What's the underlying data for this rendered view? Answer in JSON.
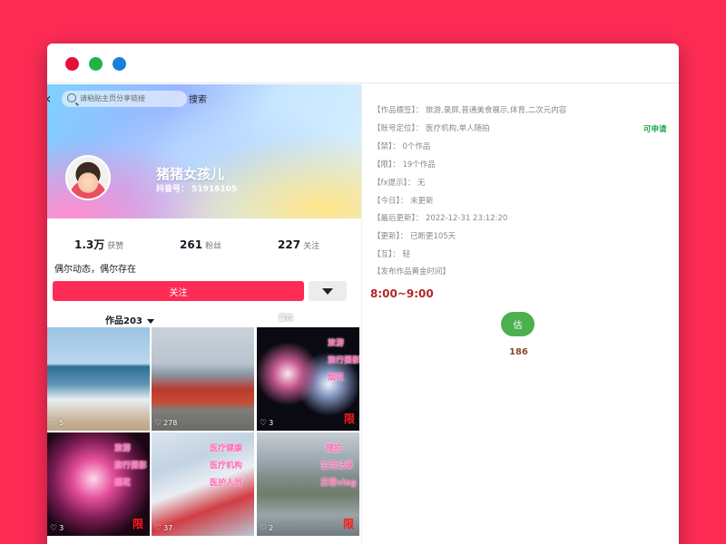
{
  "window": {
    "controls": [
      "close-dot",
      "minimize-dot",
      "maximize-dot"
    ],
    "colors": {
      "close": "#e2103a",
      "minimize": "#22b24c",
      "maximize": "#1a7fd8"
    }
  },
  "profile": {
    "search_placeholder": "请粘贴主页分享链接",
    "search_button": "搜索",
    "nickname": "猪猪女孩儿",
    "douyin_id": "抖音号： 51916105",
    "stats": [
      {
        "value": "1.3万",
        "label": "获赞"
      },
      {
        "value": "261",
        "label": "粉丝"
      },
      {
        "value": "227",
        "label": "关注"
      }
    ],
    "bio": "偶尔动态，偶尔存在",
    "follow_button": "关注",
    "tabs": {
      "works": "作品203",
      "likes": "喜欢"
    }
  },
  "grid": [
    {
      "likes": "5",
      "tags": [],
      "limit": ""
    },
    {
      "likes": "278",
      "tags": [],
      "limit": ""
    },
    {
      "likes": "3",
      "tags": [
        "旅游",
        "旅行摄影",
        "烟花"
      ],
      "limit": "限"
    },
    {
      "likes": "3",
      "tags": [
        "旅游",
        "旅行摄影",
        "烟花"
      ],
      "limit": "限"
    },
    {
      "likes": "37",
      "tags": [
        "医疗健康",
        "医疗机构",
        "医护人员"
      ],
      "limit": ""
    },
    {
      "likes": "2",
      "tags": [
        "随拍",
        "生活记录",
        "日常vlog"
      ],
      "limit": "限"
    }
  ],
  "info": {
    "lines": [
      "【作品標签】： 旅游,录屏,普通美食展示,体育,二次元内容",
      "【账号定位】： 医疗机构,单人随拍",
      "【禁】： 0个作品",
      "【限】： 19个作品",
      "【fx提示】： 无",
      "【今日】： 未更新",
      "【最后更新】： 2022-12-31 23:12:20",
      "【更新】： 已断更105天",
      "【互】： 轻",
      "【发布作品黄金时间】"
    ],
    "apply_label": "可申请",
    "golden_time": "8:00~9:00",
    "estimate_button": "估",
    "estimate_value": "186",
    "colors": {
      "accent": "#fe2c55",
      "apply": "#16a34a",
      "golden_time": "#b1272a",
      "estimate_button": "#4caf50"
    }
  }
}
